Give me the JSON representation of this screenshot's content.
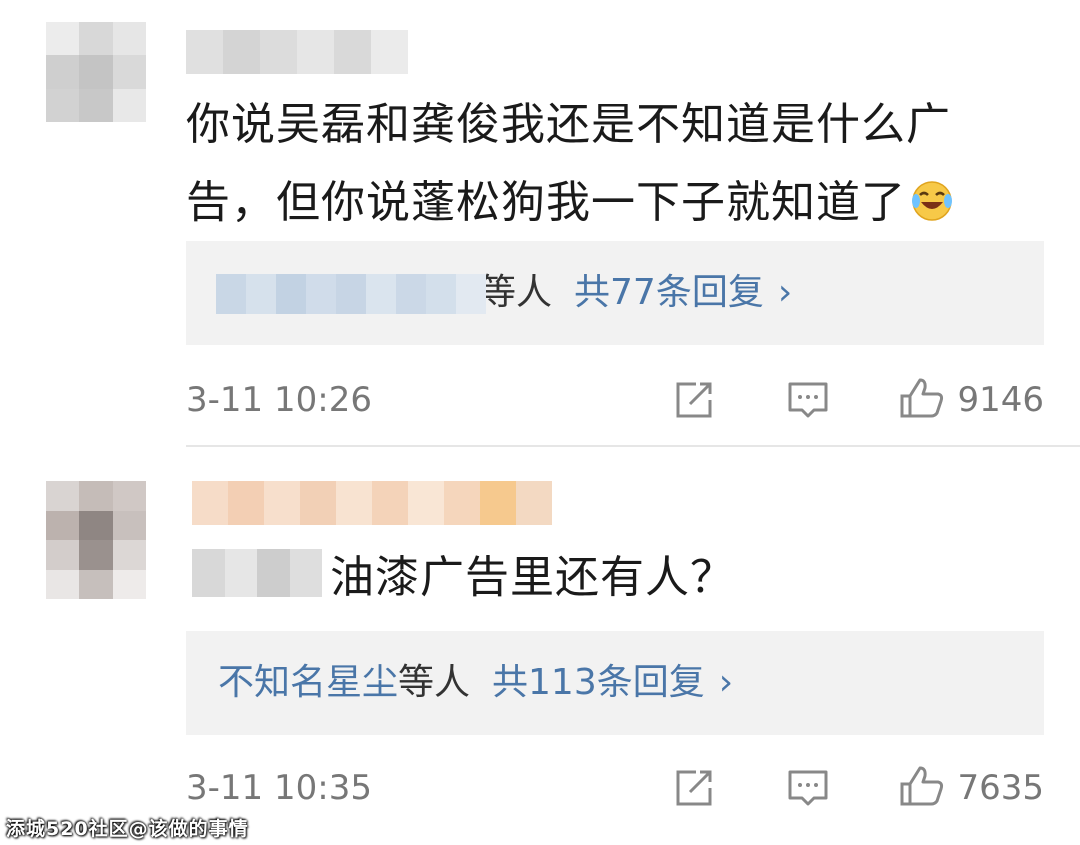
{
  "comments": [
    {
      "text_line1": "你说吴磊和龚俊我还是不知道是什么广",
      "text_line2": "告，但你说蓬松狗我一下子就知道了",
      "reply_suffix": "等人",
      "reply_count": "共77条回复",
      "chevron": "›",
      "time": "3-11 10:26",
      "likes": "9146",
      "icons": [
        "share-icon",
        "comment-icon",
        "like-icon"
      ]
    },
    {
      "text": "油漆广告里还有人？",
      "reply_names": "不知名星尘",
      "reply_suffix": "等人",
      "reply_count": "共113条回复",
      "chevron": "›",
      "time": "3-11 10:35",
      "likes": "7635",
      "icons": [
        "share-icon",
        "comment-icon",
        "like-icon"
      ]
    }
  ],
  "watermark": "添城520社区@该做的事情"
}
